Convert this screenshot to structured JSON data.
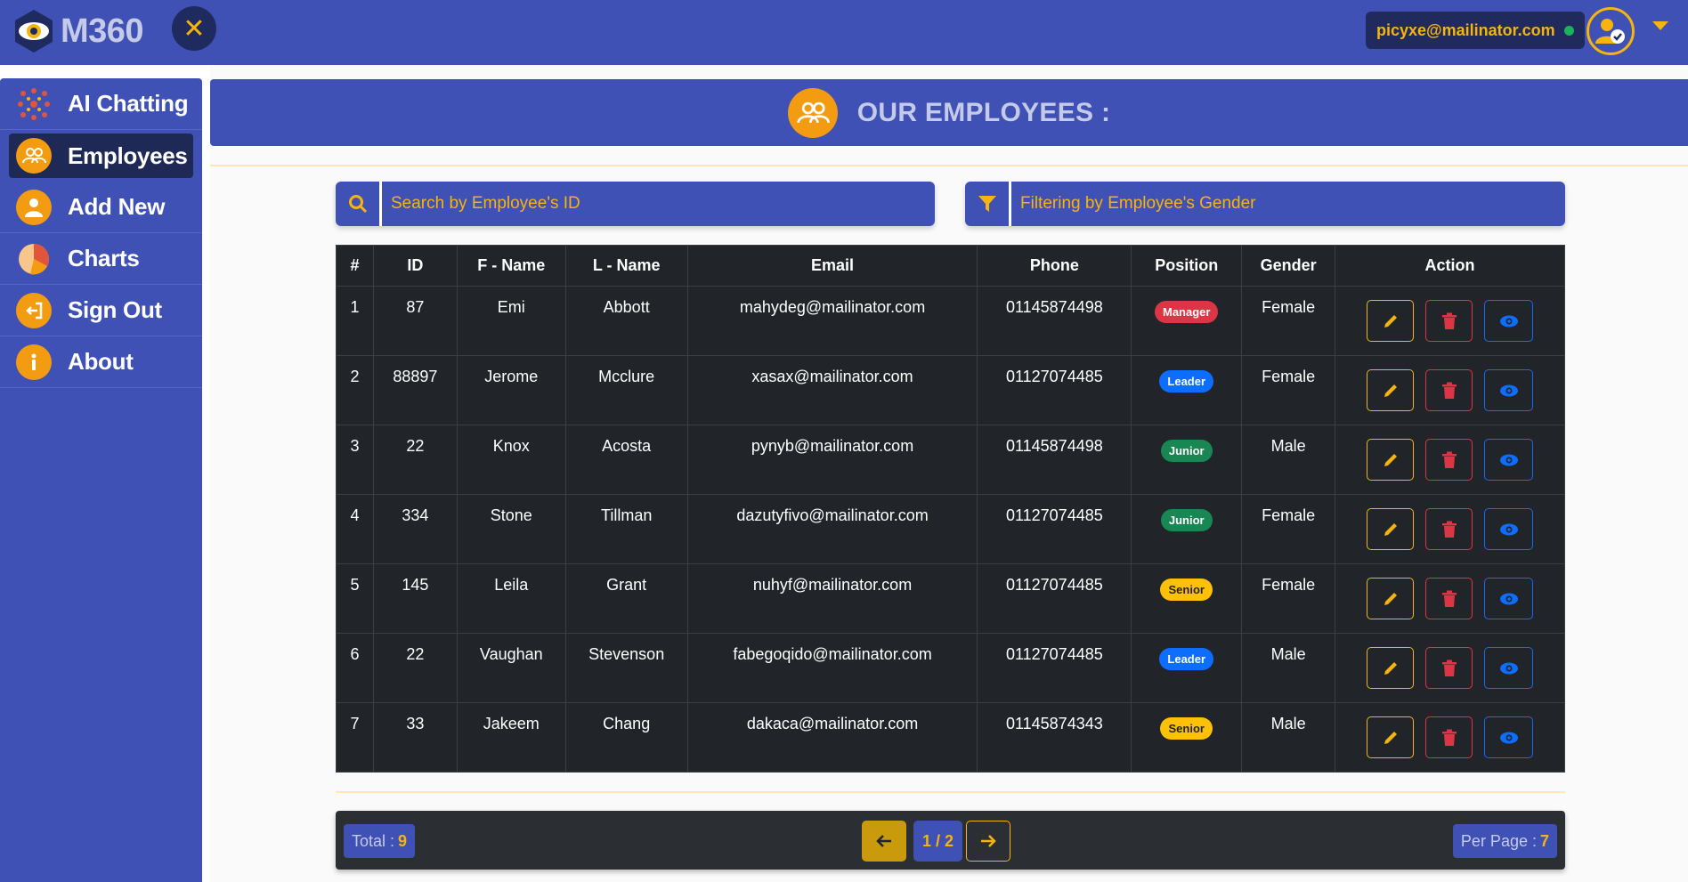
{
  "header": {
    "logo_text": "M360",
    "user_email": "picyxe@mailinator.com"
  },
  "sidebar": {
    "items": [
      {
        "label": "AI Chatting",
        "icon": "ai-network-icon"
      },
      {
        "label": "Employees",
        "icon": "users-icon",
        "active": true
      },
      {
        "label": "Add New",
        "icon": "add-user-icon"
      },
      {
        "label": "Charts",
        "icon": "pie-chart-icon"
      },
      {
        "label": "Sign Out",
        "icon": "sign-out-icon"
      },
      {
        "label": "About",
        "icon": "info-icon"
      }
    ]
  },
  "main": {
    "title": "OUR EMPLOYEES :",
    "search_placeholder": "Search by Employee's ID",
    "filter_placeholder": "Filtering by Employee's Gender"
  },
  "table": {
    "columns": [
      "#",
      "ID",
      "F - Name",
      "L - Name",
      "Email",
      "Phone",
      "Position",
      "Gender",
      "Action"
    ],
    "rows": [
      {
        "n": "1",
        "id": "87",
        "fname": "Emi",
        "lname": "Abbott",
        "email": "mahydeg@mailinator.com",
        "phone": "01145874498",
        "position": "Manager",
        "gender": "Female"
      },
      {
        "n": "2",
        "id": "88897",
        "fname": "Jerome",
        "lname": "Mcclure",
        "email": "xasax@mailinator.com",
        "phone": "01127074485",
        "position": "Leader",
        "gender": "Female"
      },
      {
        "n": "3",
        "id": "22",
        "fname": "Knox",
        "lname": "Acosta",
        "email": "pynyb@mailinator.com",
        "phone": "01145874498",
        "position": "Junior",
        "gender": "Male"
      },
      {
        "n": "4",
        "id": "334",
        "fname": "Stone",
        "lname": "Tillman",
        "email": "dazutyfivo@mailinator.com",
        "phone": "01127074485",
        "position": "Junior",
        "gender": "Female"
      },
      {
        "n": "5",
        "id": "145",
        "fname": "Leila",
        "lname": "Grant",
        "email": "nuhyf@mailinator.com",
        "phone": "01127074485",
        "position": "Senior",
        "gender": "Female"
      },
      {
        "n": "6",
        "id": "22",
        "fname": "Vaughan",
        "lname": "Stevenson",
        "email": "fabegoqido@mailinator.com",
        "phone": "01127074485",
        "position": "Leader",
        "gender": "Male"
      },
      {
        "n": "7",
        "id": "33",
        "fname": "Jakeem",
        "lname": "Chang",
        "email": "dakaca@mailinator.com",
        "phone": "01145874343",
        "position": "Senior",
        "gender": "Male"
      }
    ]
  },
  "position_colors": {
    "Manager": {
      "bg": "#dc3545",
      "fg": "#ffffff"
    },
    "Leader": {
      "bg": "#0d6efd",
      "fg": "#ffffff"
    },
    "Junior": {
      "bg": "#198754",
      "fg": "#ffffff"
    },
    "Senior": {
      "bg": "#ffc107",
      "fg": "#212529"
    }
  },
  "pagination": {
    "total_label": "Total :",
    "total_value": "9",
    "page": "1 / 2",
    "per_page_label": "Per Page :",
    "per_page_value": "7"
  },
  "colors": {
    "brand": "#3f51b5",
    "accent": "#f6b40e",
    "table_bg": "#212529"
  }
}
